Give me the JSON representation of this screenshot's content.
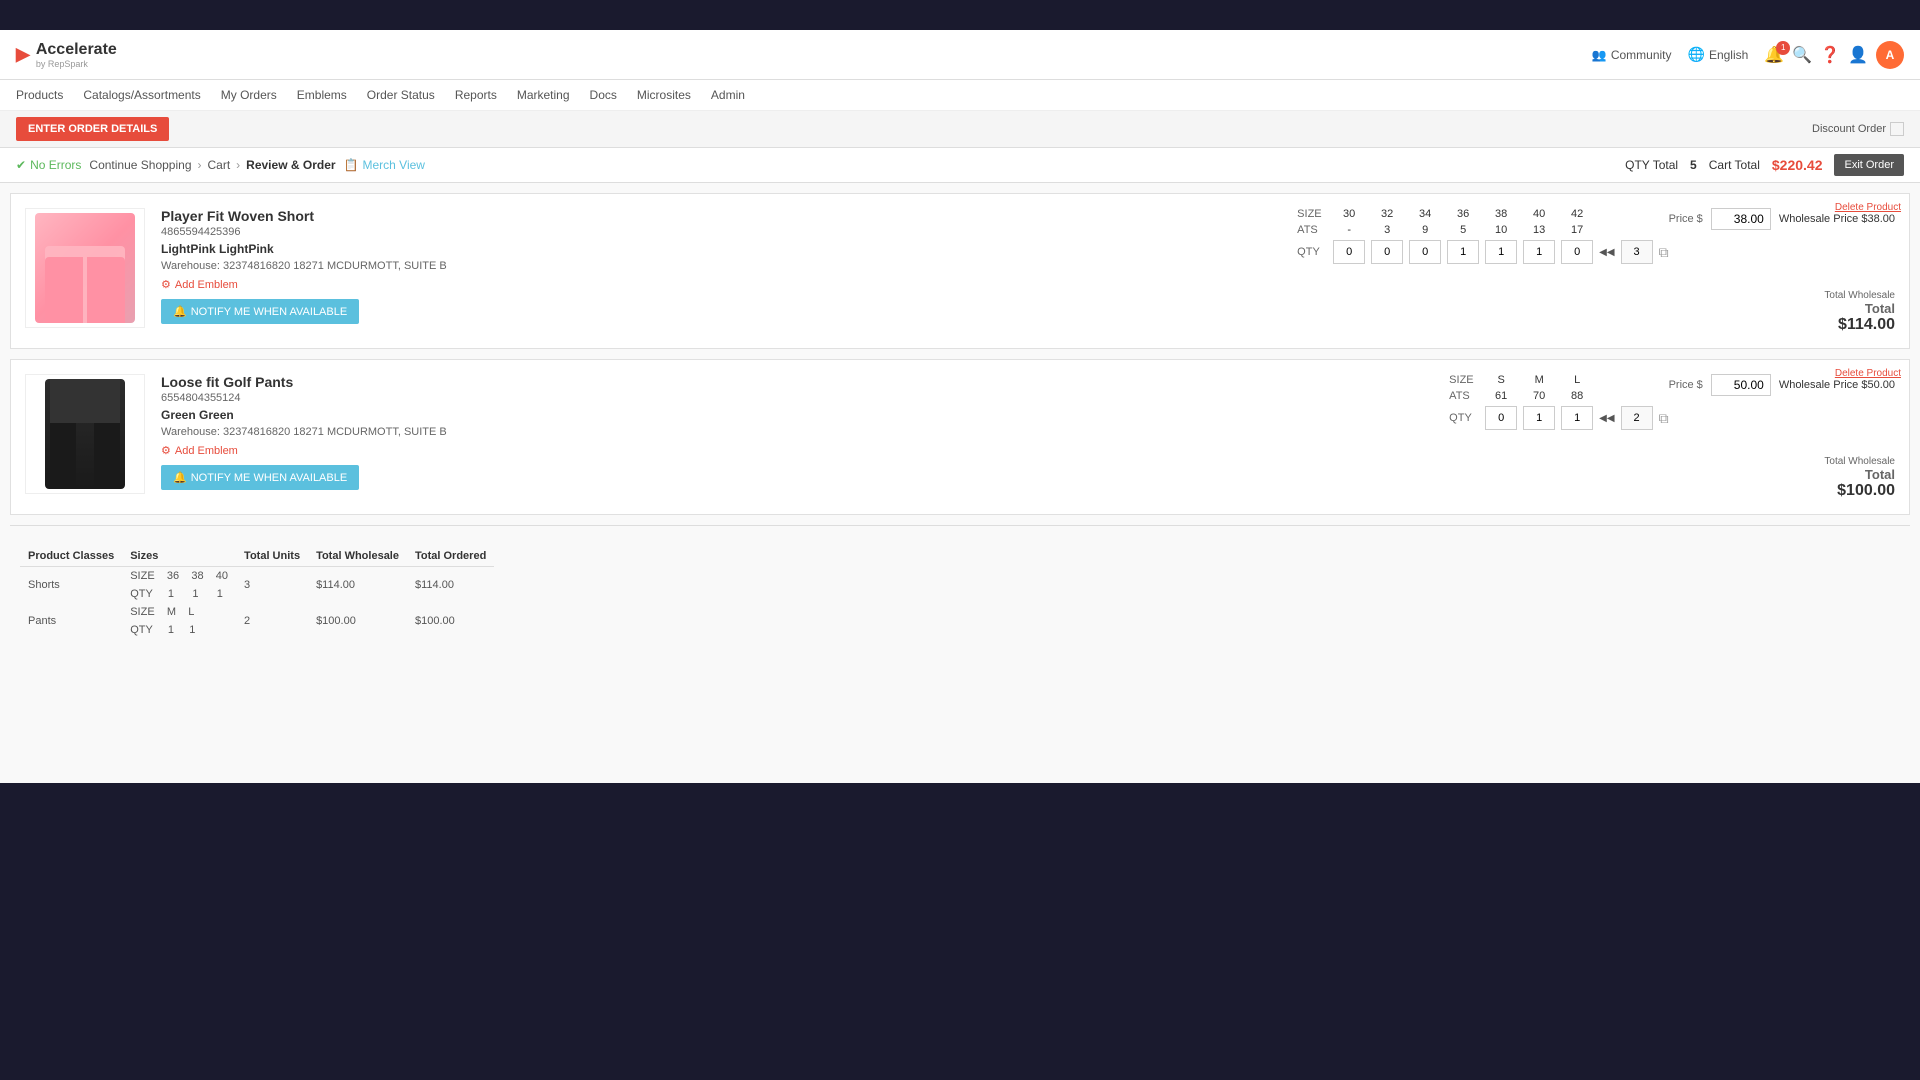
{
  "app": {
    "name": "Accelerate",
    "sub": "by RepSpark",
    "logo_icon": "▶"
  },
  "header": {
    "community_label": "Community",
    "english_label": "English",
    "nav_items": [
      "Products",
      "Catalogs/Assortments",
      "My Orders",
      "Emblems",
      "Order Status",
      "Reports",
      "Marketing",
      "Docs",
      "Microsites",
      "Admin"
    ]
  },
  "subheader": {
    "enter_order_btn": "ENTER ORDER DETAILS",
    "discount_order": "Discount Order",
    "no_errors": "No Errors",
    "breadcrumbs": [
      "Continue Shopping",
      "Cart",
      "Review & Order"
    ],
    "merch_view": "Merch View",
    "qty_total_label": "QTY Total",
    "qty_total_value": "5",
    "cart_total_label": "Cart Total",
    "cart_total_value": "$220.42",
    "exit_order": "Exit Order"
  },
  "products": [
    {
      "id": "product-1",
      "name": "Player Fit Woven Short",
      "sku": "4865594425396",
      "color": "LightPink LightPink",
      "warehouse": "Warehouse: 32374816820 18271 MCDURMOTT, SUITE B",
      "add_emblem": "Add Emblem",
      "notify_btn": "NOTIFY ME WHEN AVAILABLE",
      "price_label": "Price $",
      "price_value": "38.00",
      "wholesale_label": "Wholesale Price $38.00",
      "delete_label": "Delete Product",
      "sizes": [
        "30",
        "32",
        "34",
        "36",
        "38",
        "40",
        "42"
      ],
      "ats": [
        "-",
        "3",
        "9",
        "5",
        "10",
        "13",
        "17"
      ],
      "qty": [
        "0",
        "0",
        "0",
        "1",
        "1",
        "1",
        "0"
      ],
      "qty_total": "3",
      "total_wholesale_label": "Total Wholesale",
      "total_label": "Total",
      "total_value": "$114.00"
    },
    {
      "id": "product-2",
      "name": "Loose fit Golf Pants",
      "sku": "6554804355124",
      "color": "Green Green",
      "warehouse": "Warehouse: 32374816820 18271 MCDURMOTT, SUITE B",
      "add_emblem": "Add Emblem",
      "notify_btn": "NOTIFY ME WHEN AVAILABLE",
      "price_label": "Price $",
      "price_value": "50.00",
      "wholesale_label": "Wholesale Price $50.00",
      "delete_label": "Delete Product",
      "sizes": [
        "S",
        "M",
        "L"
      ],
      "ats": [
        "61",
        "70",
        "88"
      ],
      "qty": [
        "0",
        "1",
        "1"
      ],
      "qty_total": "2",
      "total_wholesale_label": "Total Wholesale",
      "total_label": "Total",
      "total_value": "$100.00"
    }
  ],
  "summary": {
    "headers": [
      "Product Classes",
      "Sizes",
      "Total Units",
      "Total Wholesale",
      "Total Ordered"
    ],
    "rows": [
      {
        "category": "Shorts",
        "sizes_header": [
          "36",
          "38",
          "40"
        ],
        "qty_row": [
          "1",
          "1",
          "1"
        ],
        "total_units": "3",
        "total_wholesale": "$114.00",
        "total_ordered": "$114.00"
      },
      {
        "category": "Pants",
        "sizes_header": [
          "M",
          "L"
        ],
        "qty_row": [
          "1",
          "1"
        ],
        "total_units": "2",
        "total_wholesale": "$100.00",
        "total_ordered": "$100.00"
      }
    ]
  }
}
